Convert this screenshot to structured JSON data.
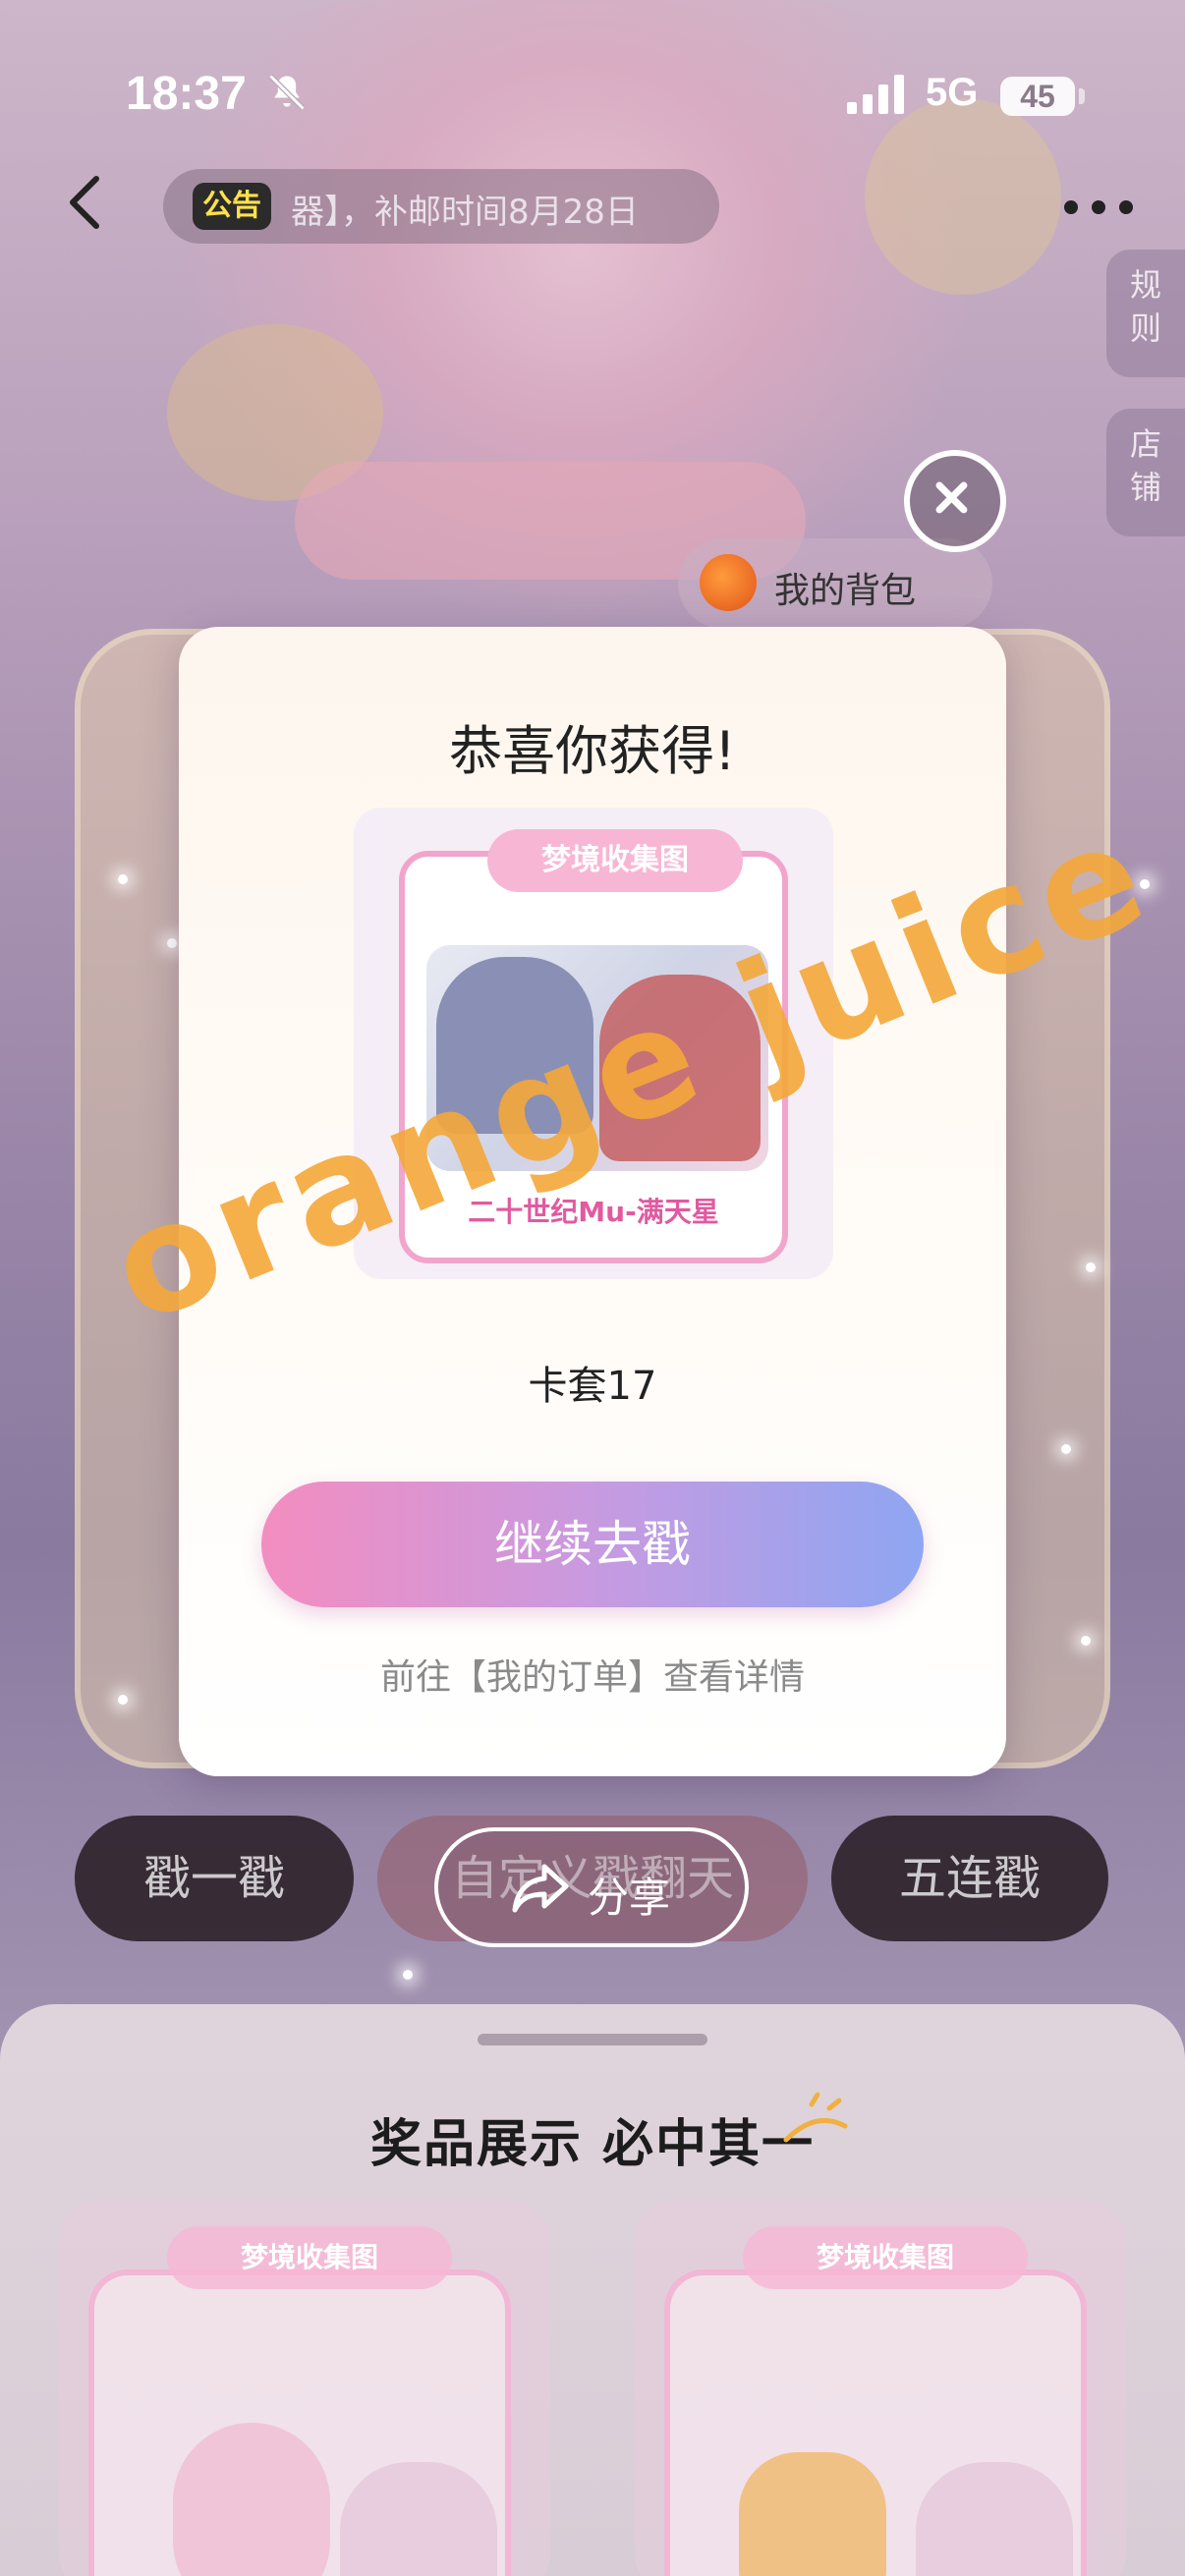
{
  "status_bar": {
    "time": "18:37",
    "network": "5G",
    "battery": "45",
    "icons": [
      "bell-muted-icon",
      "signal-icon"
    ]
  },
  "header": {
    "notice_tag": "公告",
    "notice_text": "器】，补邮时间8月28日"
  },
  "side_tabs": {
    "rules": "规则",
    "shop": "店铺"
  },
  "backpack": {
    "label": "我的背包"
  },
  "modal": {
    "title": "恭喜你获得!",
    "prize_logo": "梦境收集图",
    "prize_caption": "二十世纪Mu-满天星",
    "prize_name": "卡套17",
    "continue_label": "继续去戳",
    "order_link": "前往【我的订单】查看详情"
  },
  "watermark": "orange juice",
  "actions": {
    "draw_one": "戳一戳",
    "draw_custom": "自定义戳翻天",
    "draw_five": "五连戳",
    "share": "分享"
  },
  "prize_display": {
    "title": "奖品展示 必中其一",
    "items": [
      {
        "logo": "梦境收集图"
      },
      {
        "logo": "梦境收集图"
      }
    ]
  },
  "colors": {
    "accent_pink": "#f38dc0",
    "accent_blue": "#8ea6f2",
    "watermark": "#f4a83a"
  }
}
